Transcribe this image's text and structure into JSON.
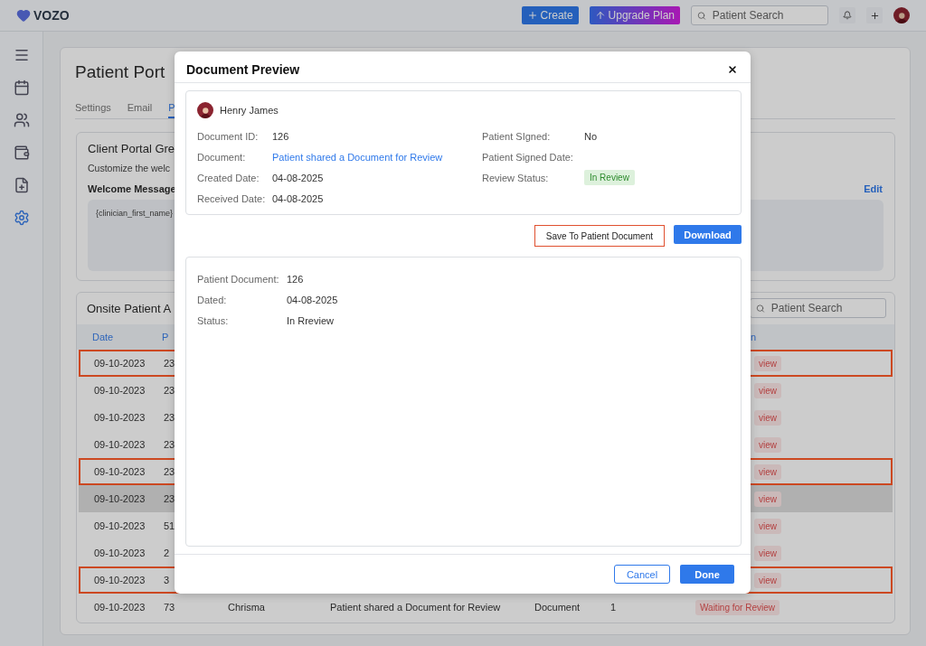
{
  "topbar": {
    "logo": "VOZO",
    "create_button": "Create",
    "upgrade_button": "Upgrade Plan",
    "search": {
      "placeholder": "Patient Search"
    }
  },
  "sidebar": {
    "items": [
      {
        "kind": "calendar",
        "selected": false
      },
      {
        "kind": "users",
        "selected": false
      },
      {
        "kind": "wallet",
        "selected": false
      },
      {
        "kind": "file",
        "selected": false
      },
      {
        "kind": "settings",
        "selected": true
      }
    ]
  },
  "page": {
    "title": "Patient Port",
    "tabs": [
      {
        "label": "Settings",
        "selected": false
      },
      {
        "label": "Email",
        "selected": false
      },
      {
        "label": "P",
        "selected": true
      }
    ]
  },
  "greeting_card": {
    "title": "Client Portal Gre",
    "description": "Customize the welc",
    "section_label": "Welcome Message",
    "edit_link": "Edit",
    "message": "{clinician_first_name}"
  },
  "activity_card": {
    "title": "Onsite Patient A",
    "search": {
      "placeholder": "Patient Search"
    },
    "columns": {
      "column_1": "Date",
      "column_2": "P",
      "column_7": "n"
    },
    "rows": [
      {
        "kind": "covered",
        "date": "09-10-2023",
        "column_2": "23",
        "status": "view",
        "flagged": true,
        "selected": false
      },
      {
        "kind": "covered",
        "date": "09-10-2023",
        "column_2": "23",
        "status": "view",
        "flagged": false,
        "selected": false
      },
      {
        "kind": "covered",
        "date": "09-10-2023",
        "column_2": "23",
        "status": "view",
        "flagged": false,
        "selected": false
      },
      {
        "kind": "covered",
        "date": "09-10-2023",
        "column_2": "23",
        "status": "view",
        "flagged": false,
        "selected": false
      },
      {
        "kind": "covered",
        "date": "09-10-2023",
        "column_2": "23",
        "status": "view",
        "flagged": true,
        "selected": false
      },
      {
        "kind": "covered",
        "date": "09-10-2023",
        "column_2": "23",
        "status": "view",
        "flagged": false,
        "selected": true
      },
      {
        "kind": "covered",
        "date": "09-10-2023",
        "column_2": "51",
        "status": "view",
        "flagged": false,
        "selected": false
      },
      {
        "kind": "covered",
        "date": "09-10-2023",
        "column_2": "2",
        "status": "view",
        "flagged": false,
        "selected": false
      },
      {
        "kind": "covered",
        "date": "09-10-2023",
        "column_2": "3",
        "status": "view",
        "flagged": true,
        "selected": false
      },
      {
        "kind": "full",
        "date": "09-10-2023",
        "column_2": "73",
        "column_3": "Chrisma",
        "column_4": "Patient shared a Document for Review",
        "column_5": "Document",
        "column_6": "1",
        "status": "Waiting for Review",
        "flagged": false,
        "selected": false
      }
    ]
  },
  "dialog": {
    "title": "Document Preview",
    "patient_name": "Henry James",
    "left_fields": [
      {
        "label": "Document ID:",
        "value": "126",
        "kind": "text"
      },
      {
        "label": "Document:",
        "value": "Patient shared a Document for Review",
        "kind": "link"
      },
      {
        "label": "Created Date:",
        "value": "04-08-2025",
        "kind": "text"
      },
      {
        "label": "Received Date:",
        "value": "04-08-2025",
        "kind": "text"
      }
    ],
    "right_fields": [
      {
        "label": "Patient SIgned:",
        "value": "No",
        "kind": "text"
      },
      {
        "label": "Patient Signed Date:",
        "kind": "text"
      },
      {
        "label": "Review Status:",
        "value": "In Review",
        "kind": "badge"
      }
    ],
    "save_button": "Save To Patient Document",
    "download_button": "Download",
    "document_fields": [
      {
        "label": "Patient Document:",
        "value": "126"
      },
      {
        "label": "Dated:",
        "value": "04-08-2025"
      },
      {
        "label": "Status:",
        "value": "In Rreview"
      }
    ],
    "cancel_button": "Cancel",
    "done_button": "Done"
  }
}
